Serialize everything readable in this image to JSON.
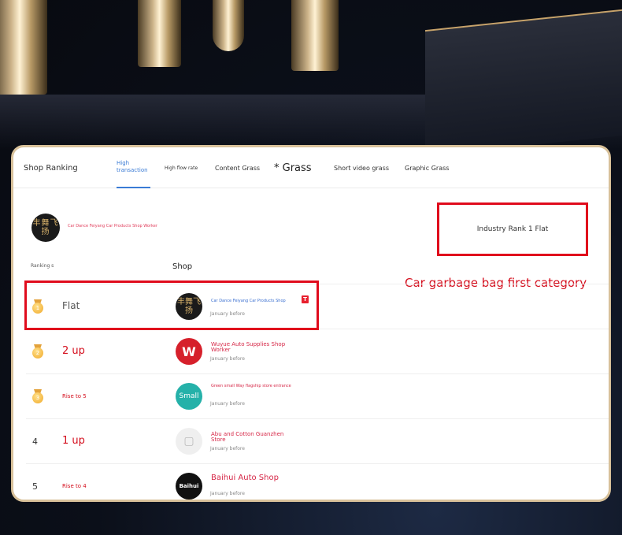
{
  "tabs": [
    {
      "label": "Shop Ranking"
    },
    {
      "label": "High transaction",
      "active": true
    },
    {
      "label": "High flow rate"
    },
    {
      "label": "Content Grass"
    },
    {
      "label": "* Grass"
    },
    {
      "label": "Short video grass"
    },
    {
      "label": "Graphic Grass"
    }
  ],
  "header_shop": {
    "logo_text": "丰舞飞扬",
    "name": "Car Dance Feiyang Car Products Shop Worker"
  },
  "industry_rank": "Industry Rank 1 Flat",
  "columns": {
    "ranking": "Ranking s",
    "shop": "Shop"
  },
  "category_note": "Car garbage bag first category",
  "rows": [
    {
      "rank": "1",
      "trend": "Flat",
      "logo": "丰舞飞扬",
      "name": "Car Dance Feiyang Car Products Shop",
      "time": "January before",
      "badge": "T"
    },
    {
      "rank": "2",
      "trend": "2 up",
      "logo": "W",
      "name": "Wuyue Auto Supplies Shop Worker",
      "time": "January before"
    },
    {
      "rank": "3",
      "trend": "Rise to 5",
      "logo": "Small",
      "name": "Green small Way flagship store entrance",
      "time": "January before"
    },
    {
      "rank": "4",
      "trend": "1 up",
      "logo": "bag",
      "name": "Abu and Cotton Guanzhen Store",
      "time": "January before"
    },
    {
      "rank": "5",
      "trend": "Rise to 4",
      "logo": "Baihui",
      "name": "Baihui Auto Shop",
      "time": "January before"
    }
  ],
  "colors": {
    "accent": "#3a7bd5",
    "highlight": "#e00b1c",
    "border": "#d8c19a"
  }
}
